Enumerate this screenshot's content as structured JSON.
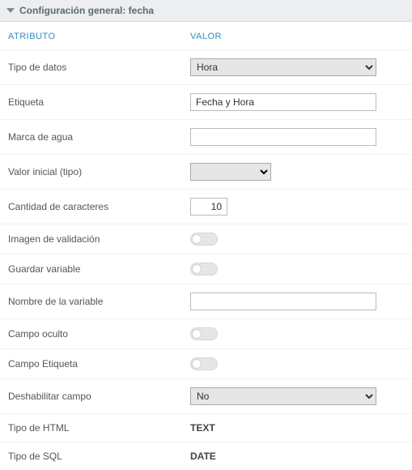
{
  "header": {
    "title": "Configuración general: fecha"
  },
  "columns": {
    "attr": "ATRIBUTO",
    "val": "VALOR"
  },
  "rows": {
    "tipo_datos": {
      "label": "Tipo de datos",
      "value": "Hora"
    },
    "etiqueta": {
      "label": "Etiqueta",
      "value": "Fecha y Hora"
    },
    "marca_agua": {
      "label": "Marca de agua",
      "value": ""
    },
    "valor_inicial": {
      "label": "Valor inicial (tipo)",
      "value": ""
    },
    "cantidad_caracteres": {
      "label": "Cantidad de caracteres",
      "value": "10"
    },
    "imagen_validacion": {
      "label": "Imagen de validación"
    },
    "guardar_variable": {
      "label": "Guardar variable"
    },
    "nombre_variable": {
      "label": "Nombre de la variable",
      "value": ""
    },
    "campo_oculto": {
      "label": "Campo oculto"
    },
    "campo_etiqueta": {
      "label": "Campo Etiqueta"
    },
    "deshabilitar": {
      "label": "Deshabilitar campo",
      "value": "No"
    },
    "tipo_html": {
      "label": "Tipo de HTML",
      "value": "TEXT"
    },
    "tipo_sql": {
      "label": "Tipo de SQL",
      "value": "DATE"
    }
  }
}
